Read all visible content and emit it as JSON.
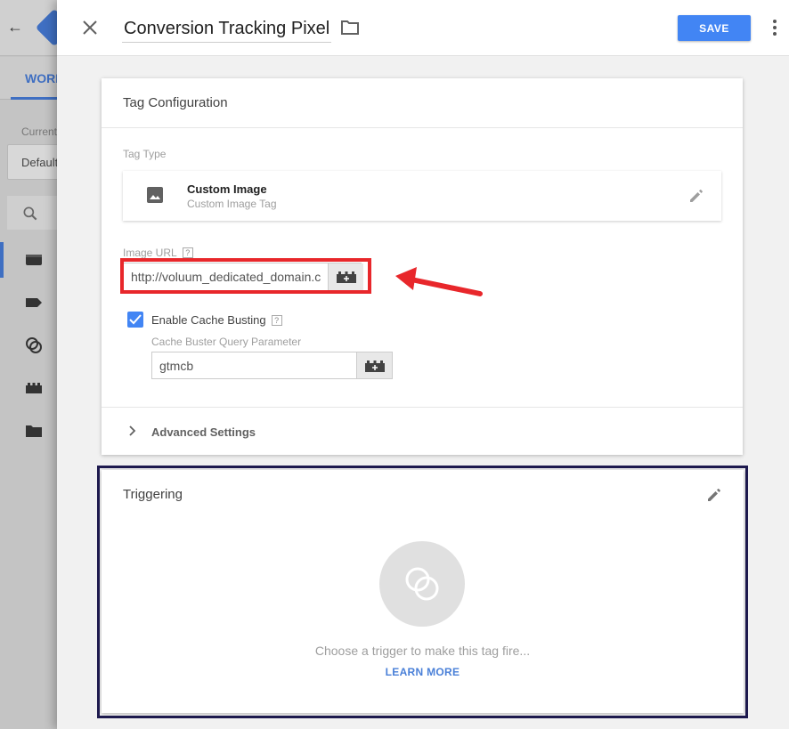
{
  "background": {
    "tab_label": "WORK",
    "current_label": "Current",
    "workspace_value": "Default"
  },
  "header": {
    "title": "Conversion Tracking Pixel",
    "save_label": "SAVE"
  },
  "tag_config": {
    "title": "Tag Configuration",
    "tag_type_label": "Tag Type",
    "tag_type_name": "Custom Image",
    "tag_type_sub": "Custom Image Tag",
    "image_url_label": "Image URL",
    "image_url_value": "http://voluum_dedicated_domain.c",
    "help_mark": "?",
    "cache_busting_label": "Enable Cache Busting",
    "cache_busting_checked": true,
    "cache_param_label": "Cache Buster Query Parameter",
    "cache_param_value": "gtmcb",
    "advanced_label": "Advanced Settings"
  },
  "triggering": {
    "title": "Triggering",
    "empty_text": "Choose a trigger to make this tag fire...",
    "learn_more": "LEARN MORE"
  },
  "colors": {
    "accent": "#4285f4",
    "highlight": "#e8272b",
    "outline": "#1e1a4f"
  }
}
